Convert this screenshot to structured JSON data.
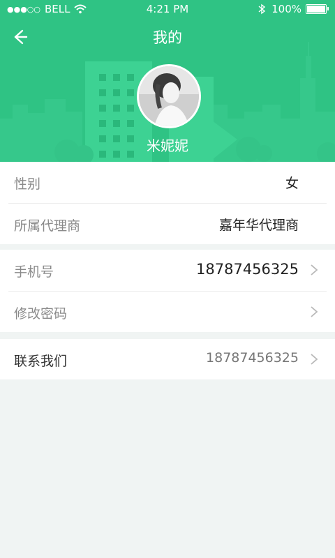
{
  "status_bar": {
    "signal_dots": "●●●○○",
    "carrier": "BELL",
    "wifi_icon": "wifi-icon",
    "time": "4:21 PM",
    "bluetooth_icon": "bluetooth-icon",
    "battery_percent": "100%",
    "battery_level": 1.0
  },
  "header": {
    "title": "我的",
    "back_icon": "back-arrow-icon",
    "avatar_icon": "avatar",
    "username": "米妮妮",
    "accent_color": "#2fc384"
  },
  "profile": {
    "gender_label": "性别",
    "gender_value": "女",
    "agent_label": "所属代理商",
    "agent_value": "嘉年华代理商"
  },
  "account": {
    "phone_label": "手机号",
    "phone_value": "18787456325",
    "password_label": "修改密码"
  },
  "contact": {
    "label": "联系我们",
    "value": "18787456325"
  }
}
